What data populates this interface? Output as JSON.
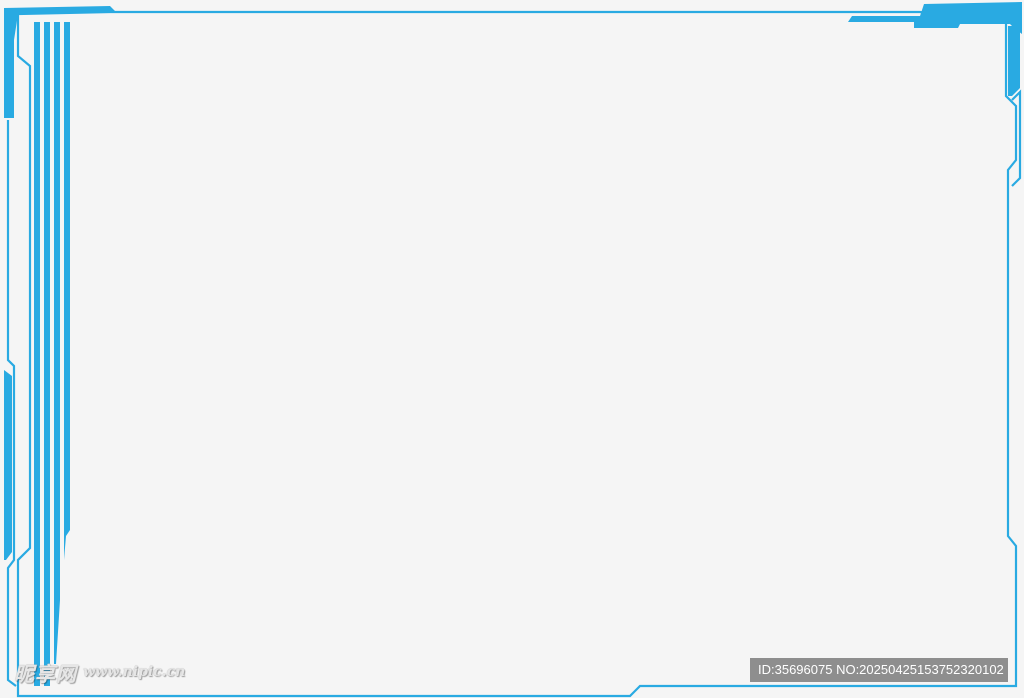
{
  "colors": {
    "frame": "#29aae2",
    "background": "#f5f5f5",
    "id_bar": "#787878"
  },
  "watermark": {
    "logo_text": "昵享网",
    "url": "www.nipic.cn"
  },
  "id_bar": {
    "text": "ID:35696075 NO:20250425153752320102"
  }
}
